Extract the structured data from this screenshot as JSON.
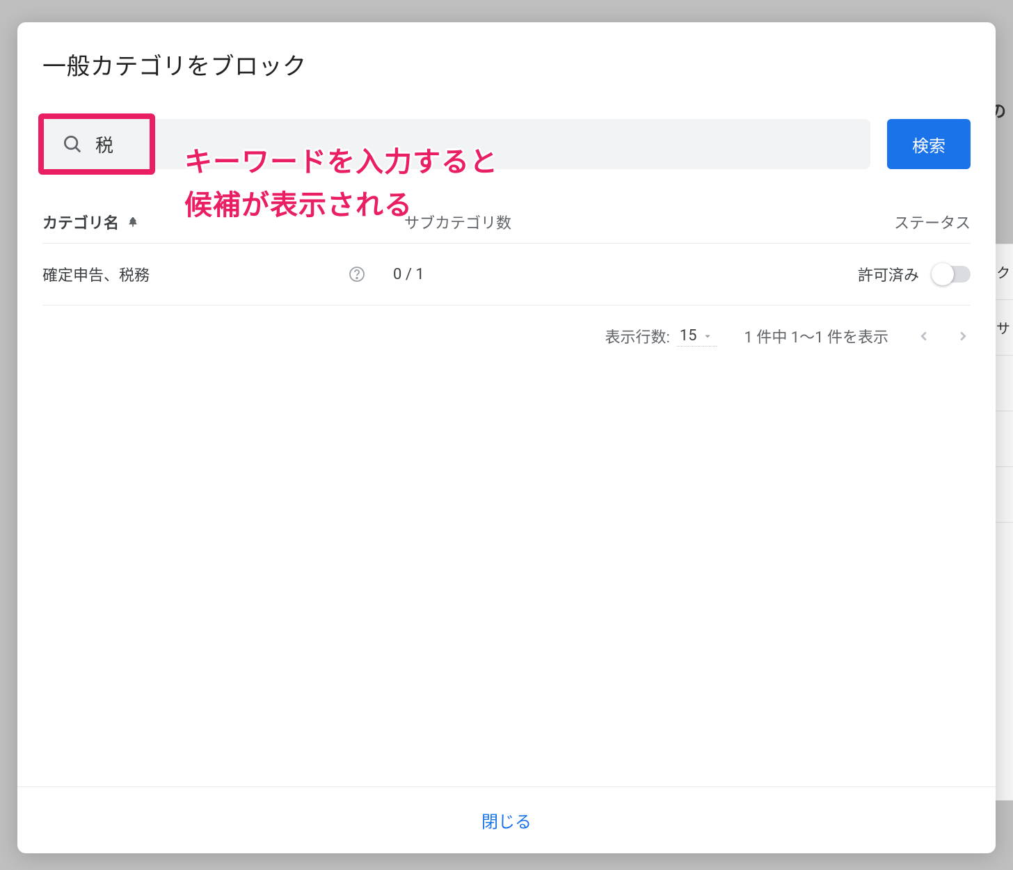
{
  "backdrop": {
    "partial_text": "の"
  },
  "modal": {
    "title": "一般カテゴリをブロック",
    "search": {
      "value": "税",
      "button_label": "検索"
    },
    "annotation": {
      "line1": "キーワードを入力すると",
      "line2": "候補が表示される"
    },
    "columns": {
      "category": "カテゴリ名",
      "subcategory": "サブカテゴリ数",
      "status": "ステータス"
    },
    "rows": [
      {
        "category": "確定申告、税務",
        "subcount": "0 / 1",
        "status_label": "許可済み"
      }
    ],
    "pagination": {
      "rows_label": "表示行数:",
      "rows_value": "15",
      "range": "1 件中 1〜1 件を表示"
    },
    "footer": {
      "close": "閉じる"
    }
  },
  "bg_side": [
    "ク",
    "サ"
  ]
}
